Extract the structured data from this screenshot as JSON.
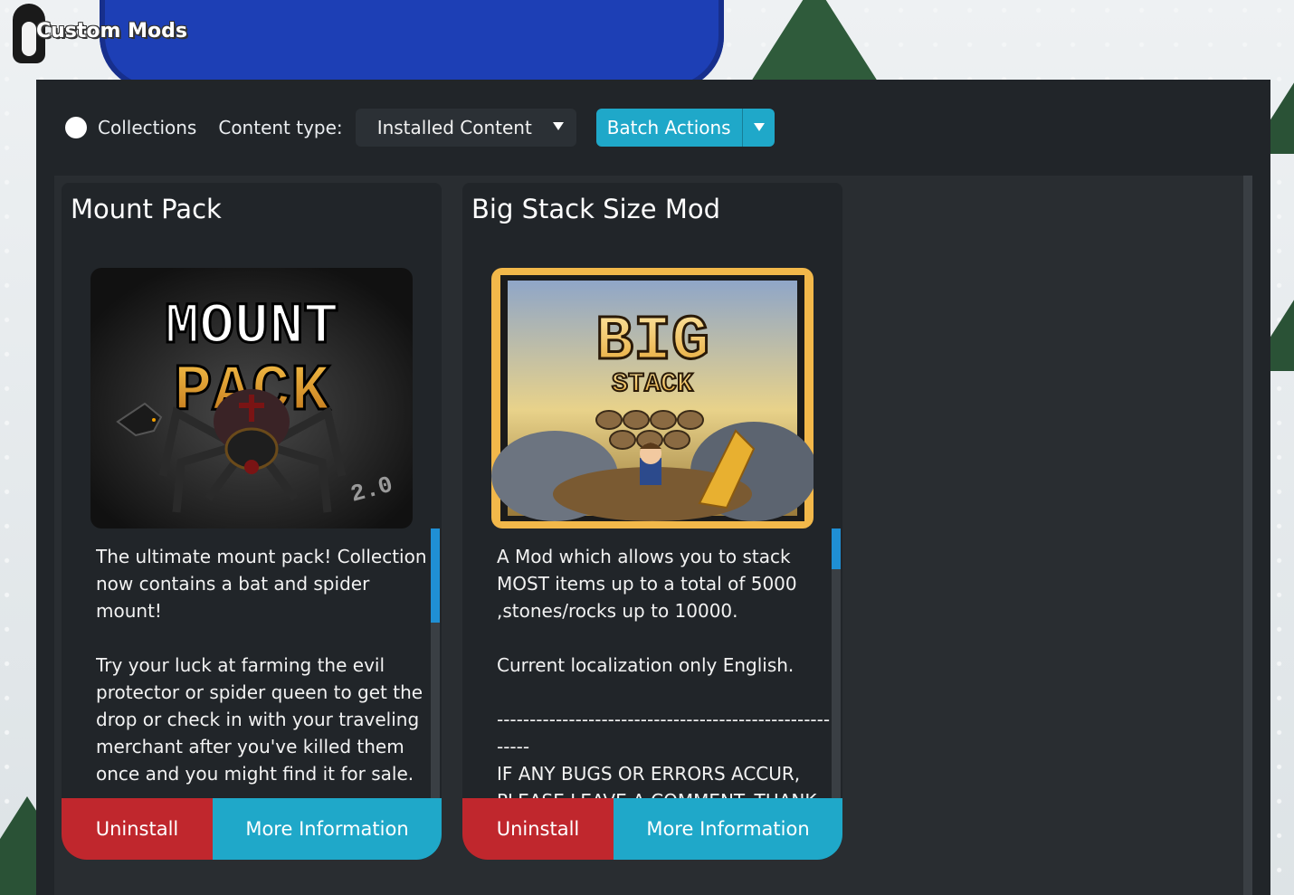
{
  "window": {
    "title": "Custom Mods"
  },
  "toolbar": {
    "collections_label": "Collections",
    "content_type_label": "Content type:",
    "content_type_value": "Installed Content",
    "batch_actions_label": "Batch Actions"
  },
  "mods": [
    {
      "title": "Mount Pack",
      "thumbnail": {
        "line1": "MOUNT",
        "line2": "PACK",
        "badge": "2.0"
      },
      "description": "The ultimate mount pack! Collection now contains a bat and spider mount!\n\nTry your luck at farming the evil protector or spider queen to get the drop or check in with your traveling merchant after you've killed them once and you might find it for sale.",
      "scroll_fraction": 0.35,
      "uninstall_label": "Uninstall",
      "more_info_label": "More Information"
    },
    {
      "title": "Big Stack Size Mod",
      "thumbnail": {
        "line1": "BIG",
        "line2": "STACK"
      },
      "description": "A Mod which allows you to stack MOST items up to a total of 5000 ,stones/rocks up to 10000.\n\nCurrent localization only English.\n\n--------------------------------------------------------\nIF ANY BUGS OR ERRORS ACCUR, PLEASE LEAVE A COMMENT. THANK",
      "scroll_fraction": 0.15,
      "uninstall_label": "Uninstall",
      "more_info_label": "More Information"
    }
  ],
  "colors": {
    "panel": "#212529",
    "uninstall": "#c0272d",
    "more_info": "#1fa8c9",
    "scroll_thumb": "#1f8fd4"
  }
}
